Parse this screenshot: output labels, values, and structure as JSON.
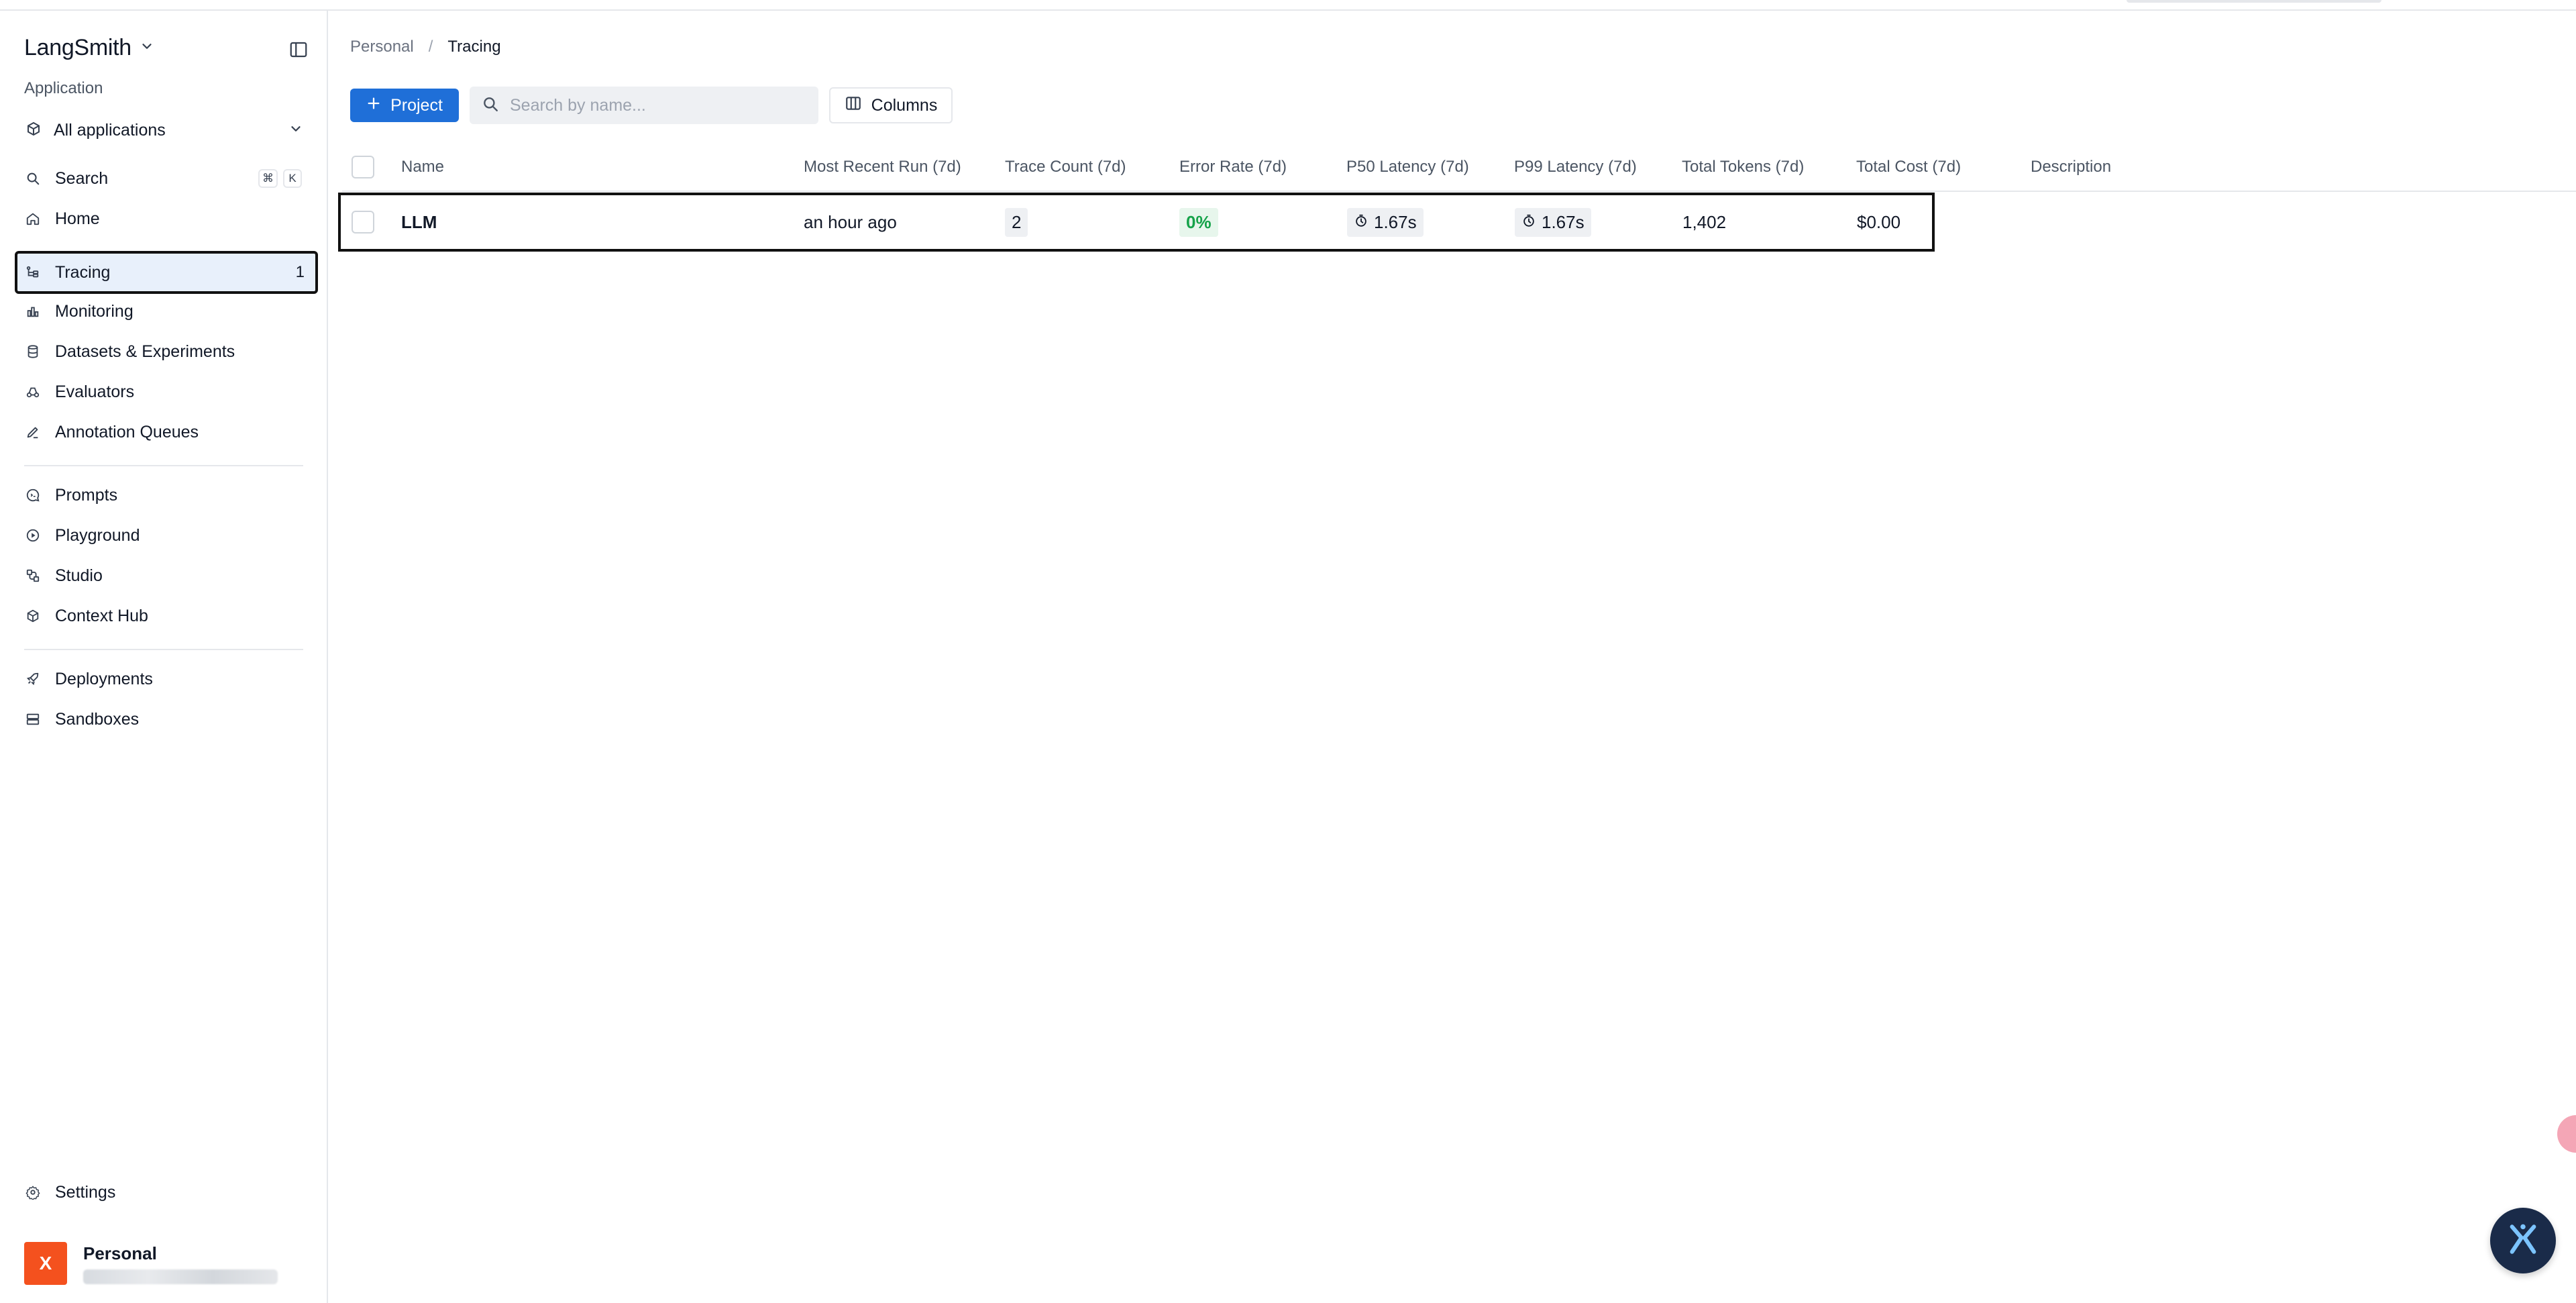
{
  "sidebar": {
    "brand": "LangSmith",
    "section_label": "Application",
    "app_select": "All applications",
    "search": {
      "label": "Search",
      "shortcut": [
        "⌘",
        "K"
      ]
    },
    "items": [
      {
        "label": "Home",
        "icon": "home-icon"
      },
      {
        "label": "Tracing",
        "icon": "tracing-icon",
        "count": "1",
        "active": true
      },
      {
        "label": "Monitoring",
        "icon": "monitoring-icon"
      },
      {
        "label": "Datasets & Experiments",
        "icon": "database-icon"
      },
      {
        "label": "Evaluators",
        "icon": "evaluators-icon"
      },
      {
        "label": "Annotation Queues",
        "icon": "pen-icon"
      },
      {
        "label": "Prompts",
        "icon": "prompts-icon"
      },
      {
        "label": "Playground",
        "icon": "playground-icon"
      },
      {
        "label": "Studio",
        "icon": "studio-icon"
      },
      {
        "label": "Context Hub",
        "icon": "cube-icon"
      },
      {
        "label": "Deployments",
        "icon": "rocket-icon"
      },
      {
        "label": "Sandboxes",
        "icon": "server-icon"
      }
    ],
    "settings": "Settings",
    "user": {
      "initial": "X",
      "name": "Personal"
    }
  },
  "breadcrumb": {
    "parent": "Personal",
    "separator": "/",
    "current": "Tracing"
  },
  "toolbar": {
    "project_label": "Project",
    "search_placeholder": "Search by name...",
    "columns_label": "Columns"
  },
  "table": {
    "columns": [
      "Name",
      "Most Recent Run (7d)",
      "Trace Count (7d)",
      "Error Rate (7d)",
      "P50 Latency (7d)",
      "P99 Latency (7d)",
      "Total Tokens (7d)",
      "Total Cost (7d)",
      "Description"
    ],
    "rows": [
      {
        "name": "LLM",
        "most_recent_run": "an hour ago",
        "trace_count": "2",
        "error_rate": "0%",
        "p50_latency": "1.67s",
        "p99_latency": "1.67s",
        "total_tokens": "1,402",
        "total_cost": "$0.00",
        "description": ""
      }
    ]
  },
  "colors": {
    "accent": "#1f6fd8",
    "active_bg": "#e8f0fb",
    "success": "#16a34a",
    "avatar": "#f4511e",
    "fab": "#1a2b49"
  }
}
